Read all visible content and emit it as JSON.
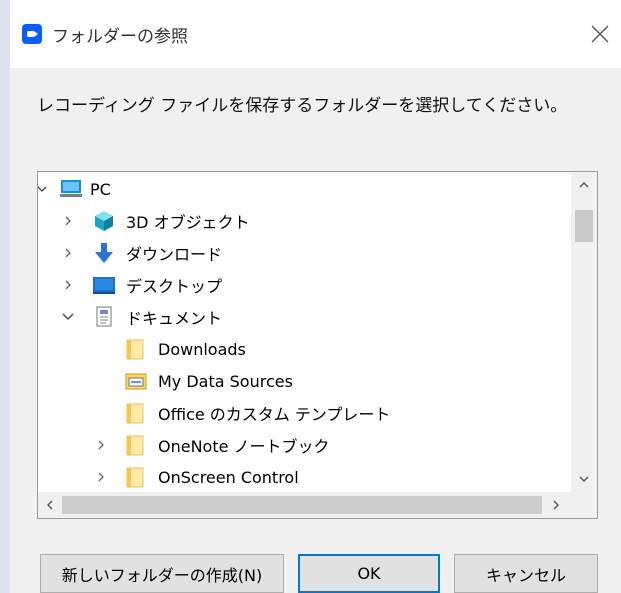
{
  "window": {
    "title": "フォルダーの参照",
    "instruction": "レコーディング ファイルを保存するフォルダーを選択してください。"
  },
  "tree": {
    "items": [
      {
        "label": "PC",
        "icon": "pc-icon",
        "expanded": true
      },
      {
        "label": "3D オブジェクト",
        "icon": "3d-objects-icon",
        "expanded": false
      },
      {
        "label": "ダウンロード",
        "icon": "download-arrow-icon",
        "expanded": false
      },
      {
        "label": "デスクトップ",
        "icon": "desktop-icon",
        "expanded": false
      },
      {
        "label": "ドキュメント",
        "icon": "documents-icon",
        "expanded": true
      },
      {
        "label": "Downloads",
        "icon": "folder-icon",
        "expanded": null
      },
      {
        "label": "My Data Sources",
        "icon": "data-sources-folder-icon",
        "expanded": null
      },
      {
        "label": "Office のカスタム テンプレート",
        "icon": "folder-icon",
        "expanded": null
      },
      {
        "label": "OneNote ノートブック",
        "icon": "folder-icon",
        "expanded": false
      },
      {
        "label": "OnScreen Control",
        "icon": "folder-icon",
        "expanded": false
      }
    ]
  },
  "buttons": {
    "new_folder": "新しいフォルダーの作成(N)",
    "ok": "OK",
    "cancel": "キャンセル"
  },
  "colors": {
    "accent": "#0078d7",
    "zoom_blue": "#0b5cff",
    "folder_yellow": "#ffd76a"
  }
}
